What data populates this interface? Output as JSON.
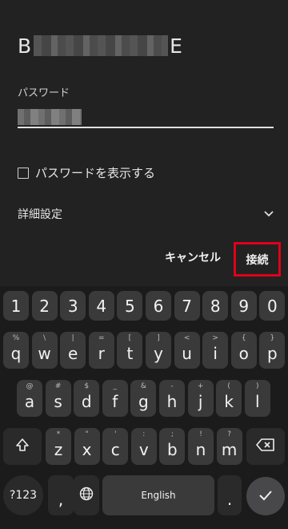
{
  "dialog": {
    "ssid_first": "B",
    "ssid_last": "E",
    "password_label": "パスワード",
    "show_password_label": "パスワードを表示する",
    "advanced_label": "詳細設定",
    "cancel_label": "キャンセル",
    "connect_label": "接続"
  },
  "keyboard": {
    "numbers": [
      "1",
      "2",
      "3",
      "4",
      "5",
      "6",
      "7",
      "8",
      "9",
      "0"
    ],
    "row1": [
      "q",
      "w",
      "e",
      "r",
      "t",
      "y",
      "u",
      "i",
      "o",
      "p"
    ],
    "row1_hints": [
      "%",
      "\\",
      "|",
      "=",
      "[",
      "]",
      "<",
      ">",
      "{",
      "}"
    ],
    "row2": [
      "a",
      "s",
      "d",
      "f",
      "g",
      "h",
      "j",
      "k",
      "l"
    ],
    "row2_hints": [
      "@",
      "#",
      "$",
      "_",
      "&",
      "-",
      "+",
      "(",
      ")"
    ],
    "row3": [
      "z",
      "x",
      "c",
      "v",
      "b",
      "n",
      "m"
    ],
    "row3_hints": [
      "*",
      "\"",
      "'",
      ":",
      ";",
      "!",
      "?"
    ],
    "symbols_label": "?123",
    "comma_label": ",",
    "space_label": "English",
    "period_label": ".",
    "shift_icon": "shift-icon",
    "backspace_icon": "backspace-icon",
    "globe_icon": "globe-icon",
    "enter_icon": "check-icon"
  }
}
